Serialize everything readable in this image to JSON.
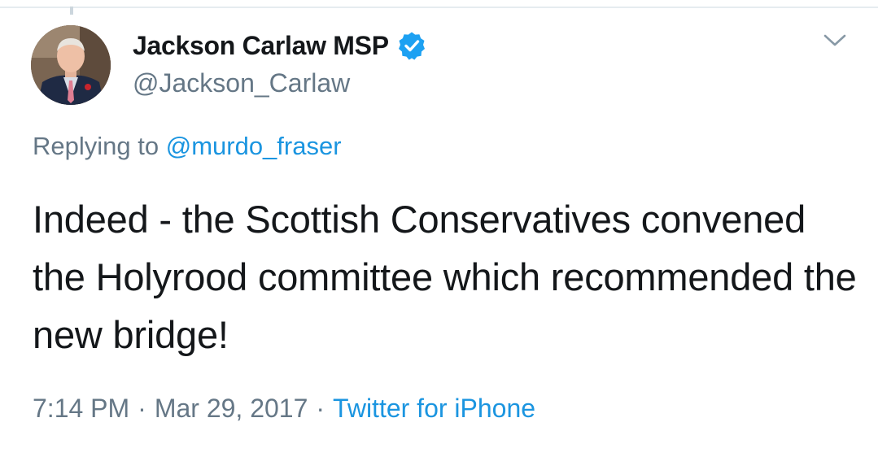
{
  "author": {
    "display_name": "Jackson Carlaw MSP",
    "handle": "@Jackson_Carlaw",
    "verified": true,
    "avatar_icon": "profile-photo"
  },
  "reply": {
    "prefix": "Replying to",
    "mention": "@murdo_fraser"
  },
  "tweet": {
    "text": "Indeed - the Scottish Conservatives convened the Holyrood committee which recommended the new bridge!"
  },
  "meta": {
    "time": "7:14 PM",
    "separator": "·",
    "date": "Mar 29, 2017",
    "source": "Twitter for iPhone"
  },
  "colors": {
    "text_primary": "#14171a",
    "text_secondary": "#657786",
    "link": "#1b95e0",
    "verified_badge": "#1da1f2"
  },
  "icons": {
    "menu": "chevron-down-icon",
    "verified": "verified-badge-icon"
  }
}
